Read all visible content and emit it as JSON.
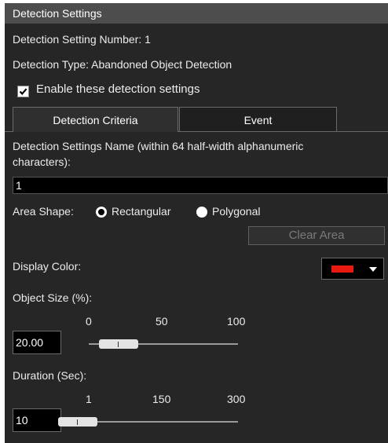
{
  "header": {
    "title": "Detection Settings"
  },
  "info": {
    "setting_number": "Detection Setting Number: 1",
    "detection_type": "Detection Type: Abandoned Object Detection"
  },
  "enable": {
    "label": "Enable these detection settings",
    "checked": true
  },
  "tabs": [
    {
      "label": "Detection Criteria",
      "active": true
    },
    {
      "label": "Event",
      "active": false
    }
  ],
  "name_field": {
    "label_line1": "Detection Settings Name (within 64 half-width alphanumeric",
    "label_line2": "characters):",
    "value": "1"
  },
  "area_shape": {
    "label": "Area Shape:",
    "options": [
      "Rectangular",
      "Polygonal"
    ],
    "selected": "Rectangular"
  },
  "clear_area": {
    "label": "Clear Area",
    "enabled": false
  },
  "display_color": {
    "label": "Display Color:",
    "color": "#e8190f"
  },
  "object_size": {
    "label": "Object Size (%):",
    "value": "20.00",
    "ticks": [
      "0",
      "50",
      "100"
    ],
    "min": 0,
    "max": 100,
    "slider_value": 20
  },
  "duration": {
    "label": "Duration (Sec):",
    "value": "10",
    "ticks": [
      "1",
      "150",
      "300"
    ],
    "min": 1,
    "max": 300,
    "slider_value": 10
  }
}
